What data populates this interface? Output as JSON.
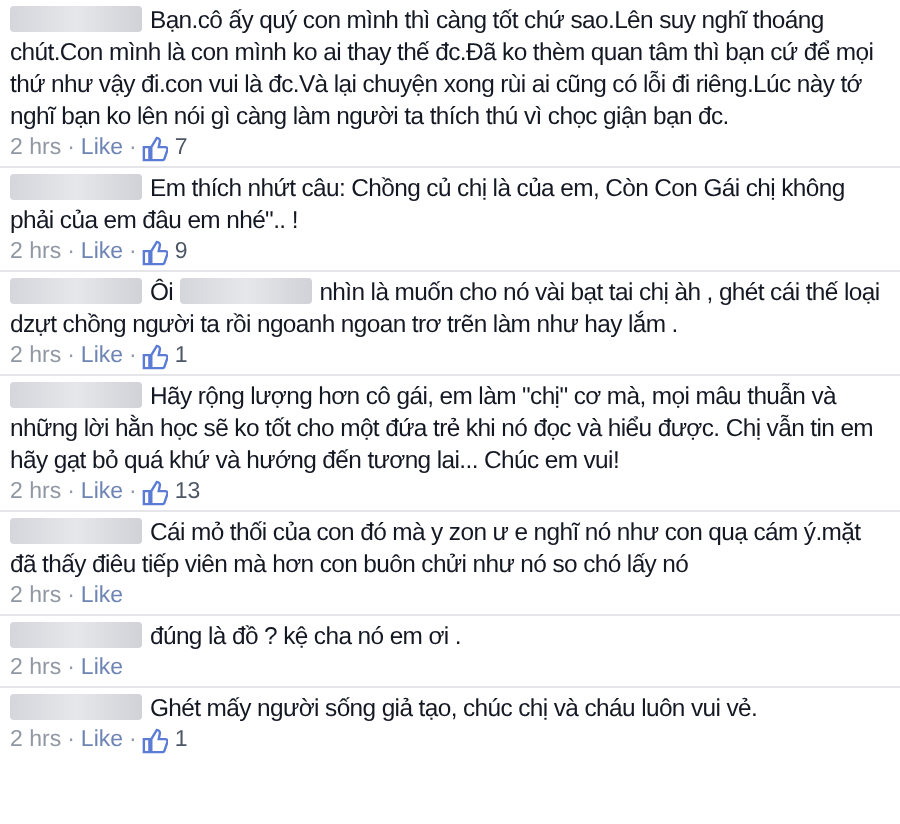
{
  "comments": [
    {
      "body": [
        {
          "kind": "redacted"
        },
        {
          "kind": "text",
          "text": "Bạn.cô ấy quý con mình thì càng tốt chứ sao.Lên suy nghĩ thoáng chút.Con mình là con mình ko ai thay thế đc.Đã ko thèm quan tâm thì bạn cứ để mọi thứ như vậy đi.con vui là đc.Và lại chuyện xong rùi ai cũng có lỗi đi riêng.Lúc này tớ nghĩ bạn ko lên nói gì càng làm người ta thích thú vì chọc giận bạn đc."
        }
      ],
      "time": "2 hrs",
      "sep": "·",
      "like": "Like",
      "likes": "7"
    },
    {
      "body": [
        {
          "kind": "redacted"
        },
        {
          "kind": "text",
          "text": "Em thích nhứt câu: Chồng củ chị là của em, Còn Con Gái chị không phải của em đâu em nhé\".. !"
        }
      ],
      "time": "2 hrs",
      "sep": "·",
      "like": "Like",
      "likes": "9"
    },
    {
      "body": [
        {
          "kind": "redacted"
        },
        {
          "kind": "text",
          "text": "Ôi"
        },
        {
          "kind": "redacted"
        },
        {
          "kind": "text",
          "text": "nhìn là muốn cho nó vài bạt tai chị àh , ghét cái thế loại dzựt chồng người ta rồi ngoanh ngoan trơ trẽn làm như hay lắm ."
        }
      ],
      "time": "2 hrs",
      "sep": "·",
      "like": "Like",
      "likes": "1"
    },
    {
      "body": [
        {
          "kind": "redacted"
        },
        {
          "kind": "text",
          "text": "Hãy rộng lượng hơn cô gái, em làm \"chị\" cơ mà, mọi mâu thuẫn và những lời hằn học sẽ ko tốt cho một đứa trẻ khi nó đọc và hiểu được. Chị vẫn tin em hãy gạt bỏ quá khứ và hướng đến tương lai... Chúc em vui!"
        }
      ],
      "time": "2 hrs",
      "sep": "·",
      "like": "Like",
      "likes": "13"
    },
    {
      "body": [
        {
          "kind": "redacted"
        },
        {
          "kind": "text",
          "text": "Cái mỏ thối của con đó mà y zon ư e nghĩ nó như con quạ cám ý.mặt đã thấy điêu tiếp viên mà hơn con buôn chửi như nó so chó lấy nó"
        }
      ],
      "time": "2 hrs",
      "sep": "·",
      "like": "Like"
    },
    {
      "body": [
        {
          "kind": "redacted"
        },
        {
          "kind": "text",
          "text": "đúng là đồ ? kệ cha nó em ơi ."
        }
      ],
      "time": "2 hrs",
      "sep": "·",
      "like": "Like"
    },
    {
      "body": [
        {
          "kind": "redacted"
        },
        {
          "kind": "text",
          "text": "Ghét mấy người sống giả tạo, chúc chị và cháu luôn vui vẻ."
        }
      ],
      "time": "2 hrs",
      "sep": "·",
      "like": "Like",
      "likes": "1"
    }
  ]
}
